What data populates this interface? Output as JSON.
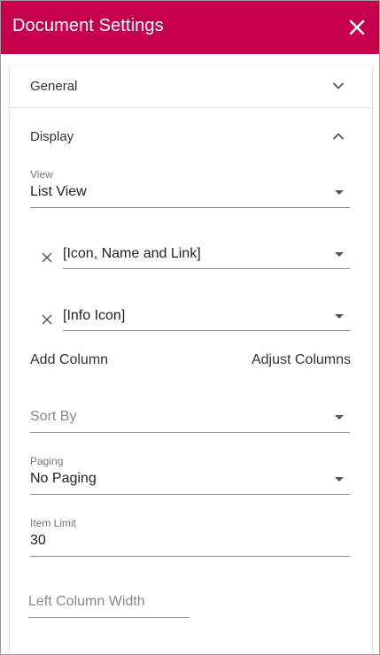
{
  "header": {
    "title": "Document Settings",
    "close_icon": "close-icon",
    "background_color": "#c8004c"
  },
  "sections": {
    "general": {
      "label": "General",
      "state": "collapsed",
      "icon": "chevron-down-icon"
    },
    "display": {
      "label": "Display",
      "state": "expanded",
      "icon": "chevron-up-icon"
    }
  },
  "display": {
    "view": {
      "label": "View",
      "value": "List View"
    },
    "columns": [
      {
        "value": "[Icon, Name and Link]"
      },
      {
        "value": "[Info Icon]"
      }
    ],
    "add_column_label": "Add Column",
    "adjust_columns_label": "Adjust Columns",
    "sort_by": {
      "placeholder": "Sort By",
      "value": ""
    },
    "paging": {
      "label": "Paging",
      "value": "No Paging"
    },
    "item_limit": {
      "label": "Item Limit",
      "value": "30"
    },
    "left_column_width": {
      "placeholder": "Left Column Width",
      "value": ""
    }
  }
}
